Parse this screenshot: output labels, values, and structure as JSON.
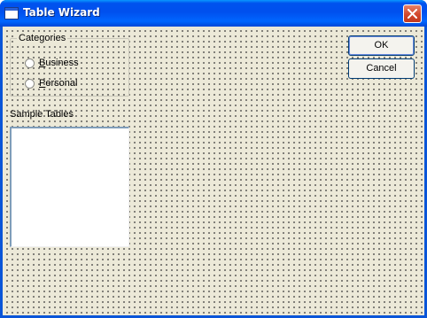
{
  "window": {
    "title": "Table Wizard"
  },
  "categories": {
    "label": "Categories",
    "options": [
      {
        "underline": "B",
        "rest": "usiness"
      },
      {
        "underline": "P",
        "rest": "ersonal"
      }
    ]
  },
  "sample_tables": {
    "label": "Sample Tables"
  },
  "buttons": {
    "ok": "OK",
    "cancel": "Cancel"
  },
  "icons": {
    "title": "window-icon",
    "close": "close-icon"
  },
  "colors": {
    "titlebar": "#0053ee",
    "client_bg": "#ece9d8",
    "close_btn": "#d2482c",
    "button_border": "#003c74"
  }
}
